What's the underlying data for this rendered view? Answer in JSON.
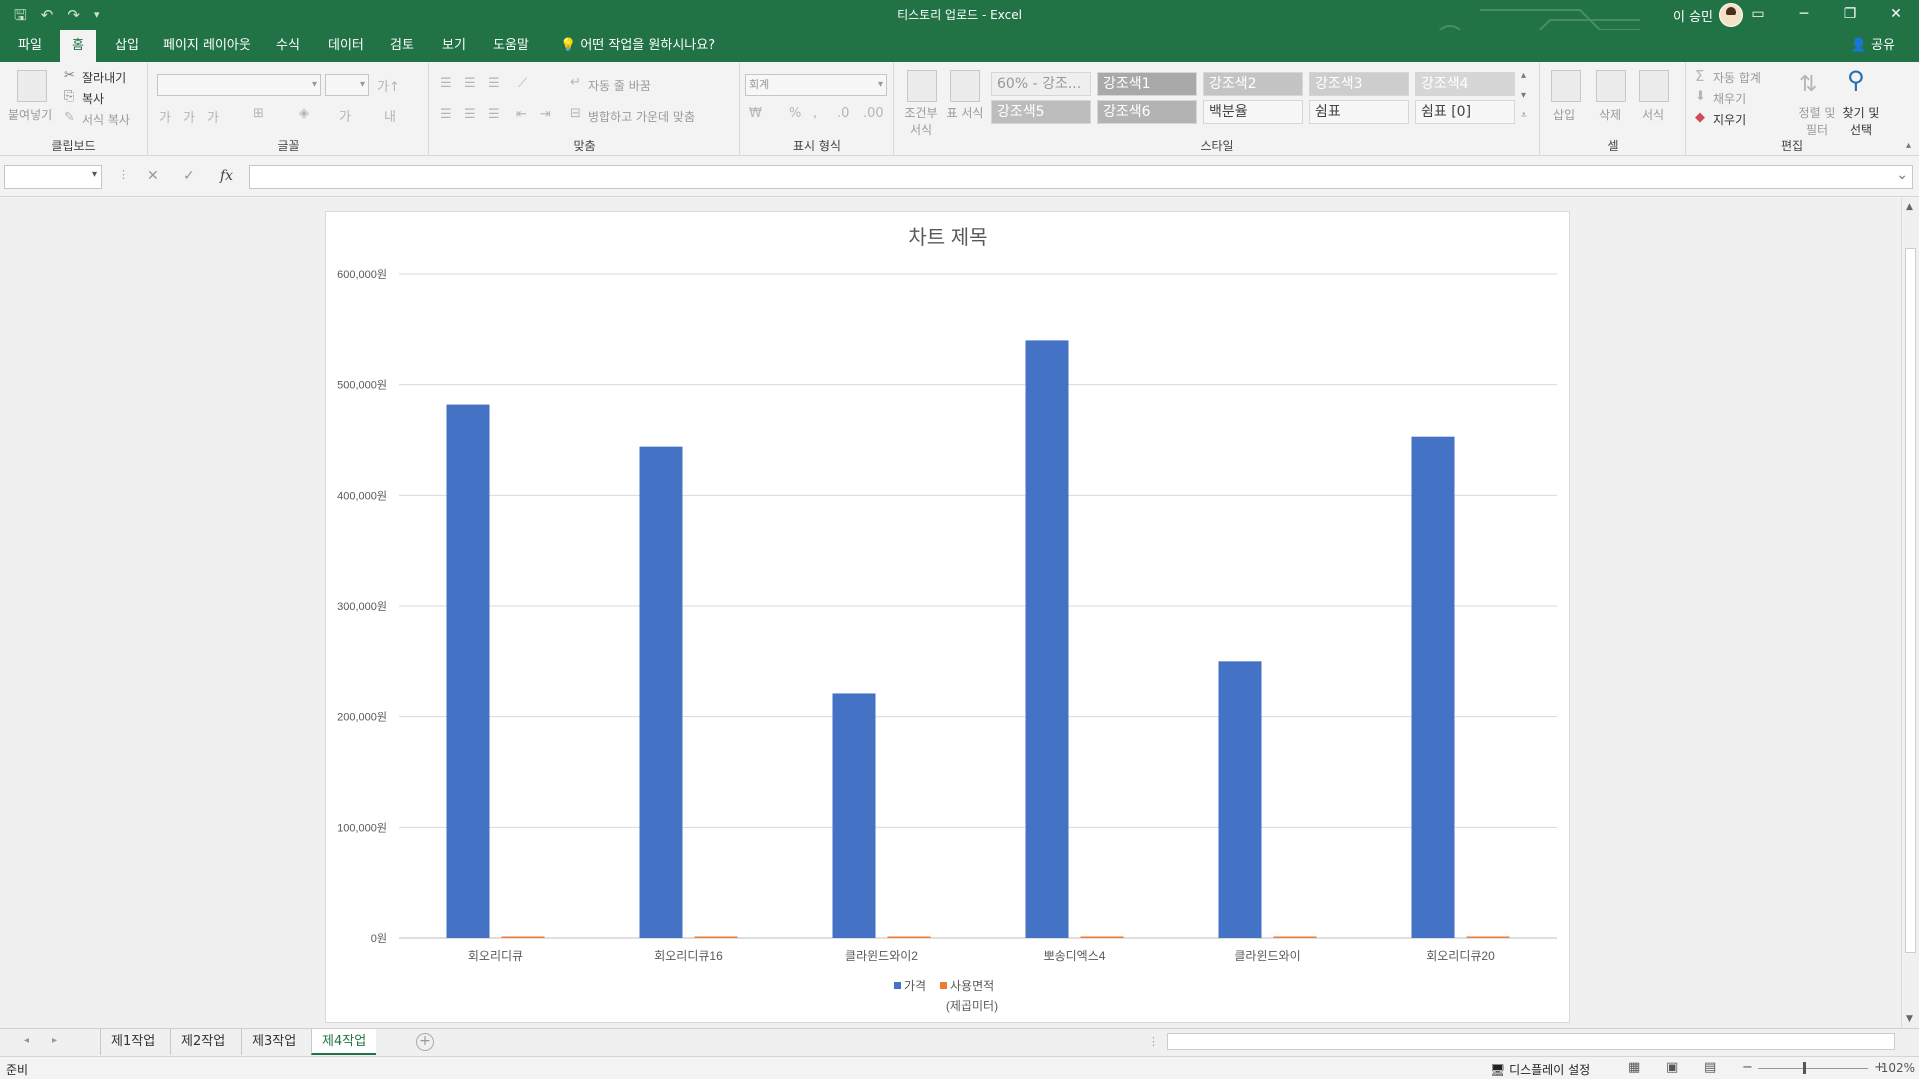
{
  "window": {
    "title": "티스토리 업로드  -  Excel",
    "user": "이 승민",
    "theme_color": "#217346"
  },
  "quick_access": {
    "icons": [
      "save-icon",
      "undo-icon",
      "redo-icon",
      "customize-icon"
    ]
  },
  "ribbon_tabs": {
    "items": [
      "파일",
      "홈",
      "삽입",
      "페이지 레이아웃",
      "수식",
      "데이터",
      "검토",
      "보기",
      "도움말"
    ],
    "active": "홈",
    "tell_me": "어떤 작업을 원하시나요?",
    "share": "공유"
  },
  "ribbon": {
    "clipboard": {
      "paste": "붙여넣기",
      "cut": "잘라내기",
      "copy": "복사",
      "format_painter": "서식 복사",
      "label": "클립보드"
    },
    "font": {
      "label": "글꼴"
    },
    "alignment": {
      "wrap_text": "자동 줄 바꿈",
      "merge_center": "병합하고 가운데 맞춤",
      "label": "맞춤"
    },
    "number": {
      "format": "회계",
      "label": "표시 형식"
    },
    "styles": {
      "conditional": "조건부 서식",
      "table_format": "표 서식",
      "cells": [
        "60% - 강조...",
        "강조색1",
        "강조색2",
        "강조색3",
        "강조색4",
        "강조색5",
        "강조색6",
        "백분율",
        "쉼표",
        "쉼표 [0]"
      ],
      "label": "스타일"
    },
    "cells_group": {
      "insert": "삽입",
      "delete": "삭제",
      "format": "서식",
      "label": "셀"
    },
    "editing": {
      "autosum": "자동 합계",
      "fill": "채우기",
      "clear": "지우기",
      "sort_filter": "정렬 및 필터",
      "find_select": "찾기 및 선택",
      "label": "편집"
    }
  },
  "formula_bar": {
    "name_box": "",
    "formula": "",
    "fx": "fx"
  },
  "chart_data": {
    "type": "bar",
    "title": "차트 제목",
    "categories": [
      "회오리디큐",
      "회오리디큐16",
      "클라윈드와이2",
      "뽀송디엑스4",
      "클라윈드와이",
      "회오리디큐20"
    ],
    "series": [
      {
        "name": "가격",
        "color": "#4472C4",
        "values": [
          482000,
          444000,
          221000,
          540000,
          250000,
          453000
        ]
      },
      {
        "name": "사용면적\n(제곱미터)",
        "color": "#ED7D31",
        "values": [
          50,
          55,
          40,
          60,
          45,
          50
        ]
      }
    ],
    "legend_names": [
      "가격",
      "사용면적",
      "(제곱미터)"
    ],
    "ylim": [
      0,
      600000
    ],
    "y_ticks": [
      "0원",
      "100,000원",
      "200,000원",
      "300,000원",
      "400,000원",
      "500,000원",
      "600,000원"
    ],
    "grid": true,
    "legend_position": "bottom"
  },
  "sheet_tabs": {
    "items": [
      "제1작업",
      "제2작업",
      "제3작업",
      "제4작업"
    ],
    "active": "제4작업"
  },
  "status": {
    "ready": "준비",
    "display_settings": "디스플레이 설정",
    "zoom": "102%"
  }
}
